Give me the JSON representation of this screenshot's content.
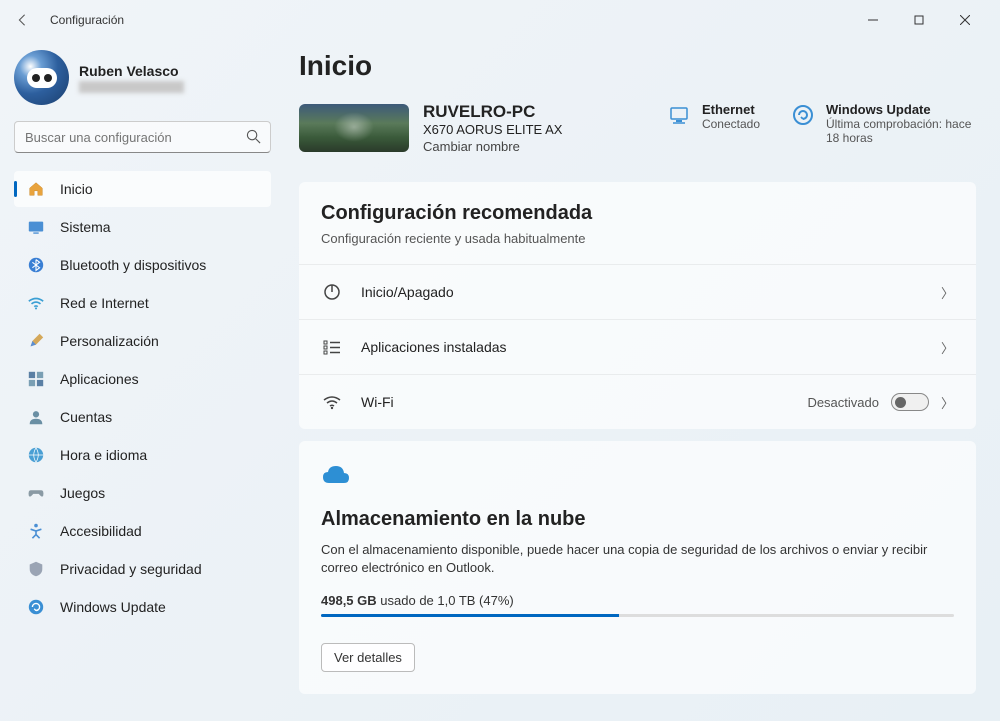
{
  "window": {
    "title": "Configuración"
  },
  "user": {
    "name": "Ruben Velasco"
  },
  "search": {
    "placeholder": "Buscar una configuración"
  },
  "nav": {
    "home": "Inicio",
    "system": "Sistema",
    "bluetooth": "Bluetooth y dispositivos",
    "network": "Red e Internet",
    "personalization": "Personalización",
    "apps": "Aplicaciones",
    "accounts": "Cuentas",
    "time": "Hora e idioma",
    "gaming": "Juegos",
    "accessibility": "Accesibilidad",
    "privacy": "Privacidad y seguridad",
    "update": "Windows Update"
  },
  "page": {
    "title": "Inicio"
  },
  "device": {
    "name": "RUVELRO-PC",
    "model": "X670 AORUS ELITE AX",
    "rename": "Cambiar nombre"
  },
  "ethernet": {
    "title": "Ethernet",
    "status": "Conectado"
  },
  "update": {
    "title": "Windows Update",
    "status": "Última comprobación: hace 18 horas"
  },
  "recommended": {
    "title": "Configuración recomendada",
    "subtitle": "Configuración reciente y usada habitualmente",
    "power": "Inicio/Apagado",
    "apps": "Aplicaciones instaladas",
    "wifi": "Wi-Fi",
    "wifi_state": "Desactivado"
  },
  "cloud": {
    "title": "Almacenamiento en la nube",
    "desc": "Con el almacenamiento disponible, puede hacer una copia de seguridad de los archivos o enviar y recibir correo electrónico en Outlook.",
    "used_amount": "498,5 GB",
    "used_of": "usado de 1,0 TB (47%)",
    "percent": 47,
    "details_btn": "Ver detalles"
  },
  "colors": {
    "accent": "#0067c0"
  }
}
